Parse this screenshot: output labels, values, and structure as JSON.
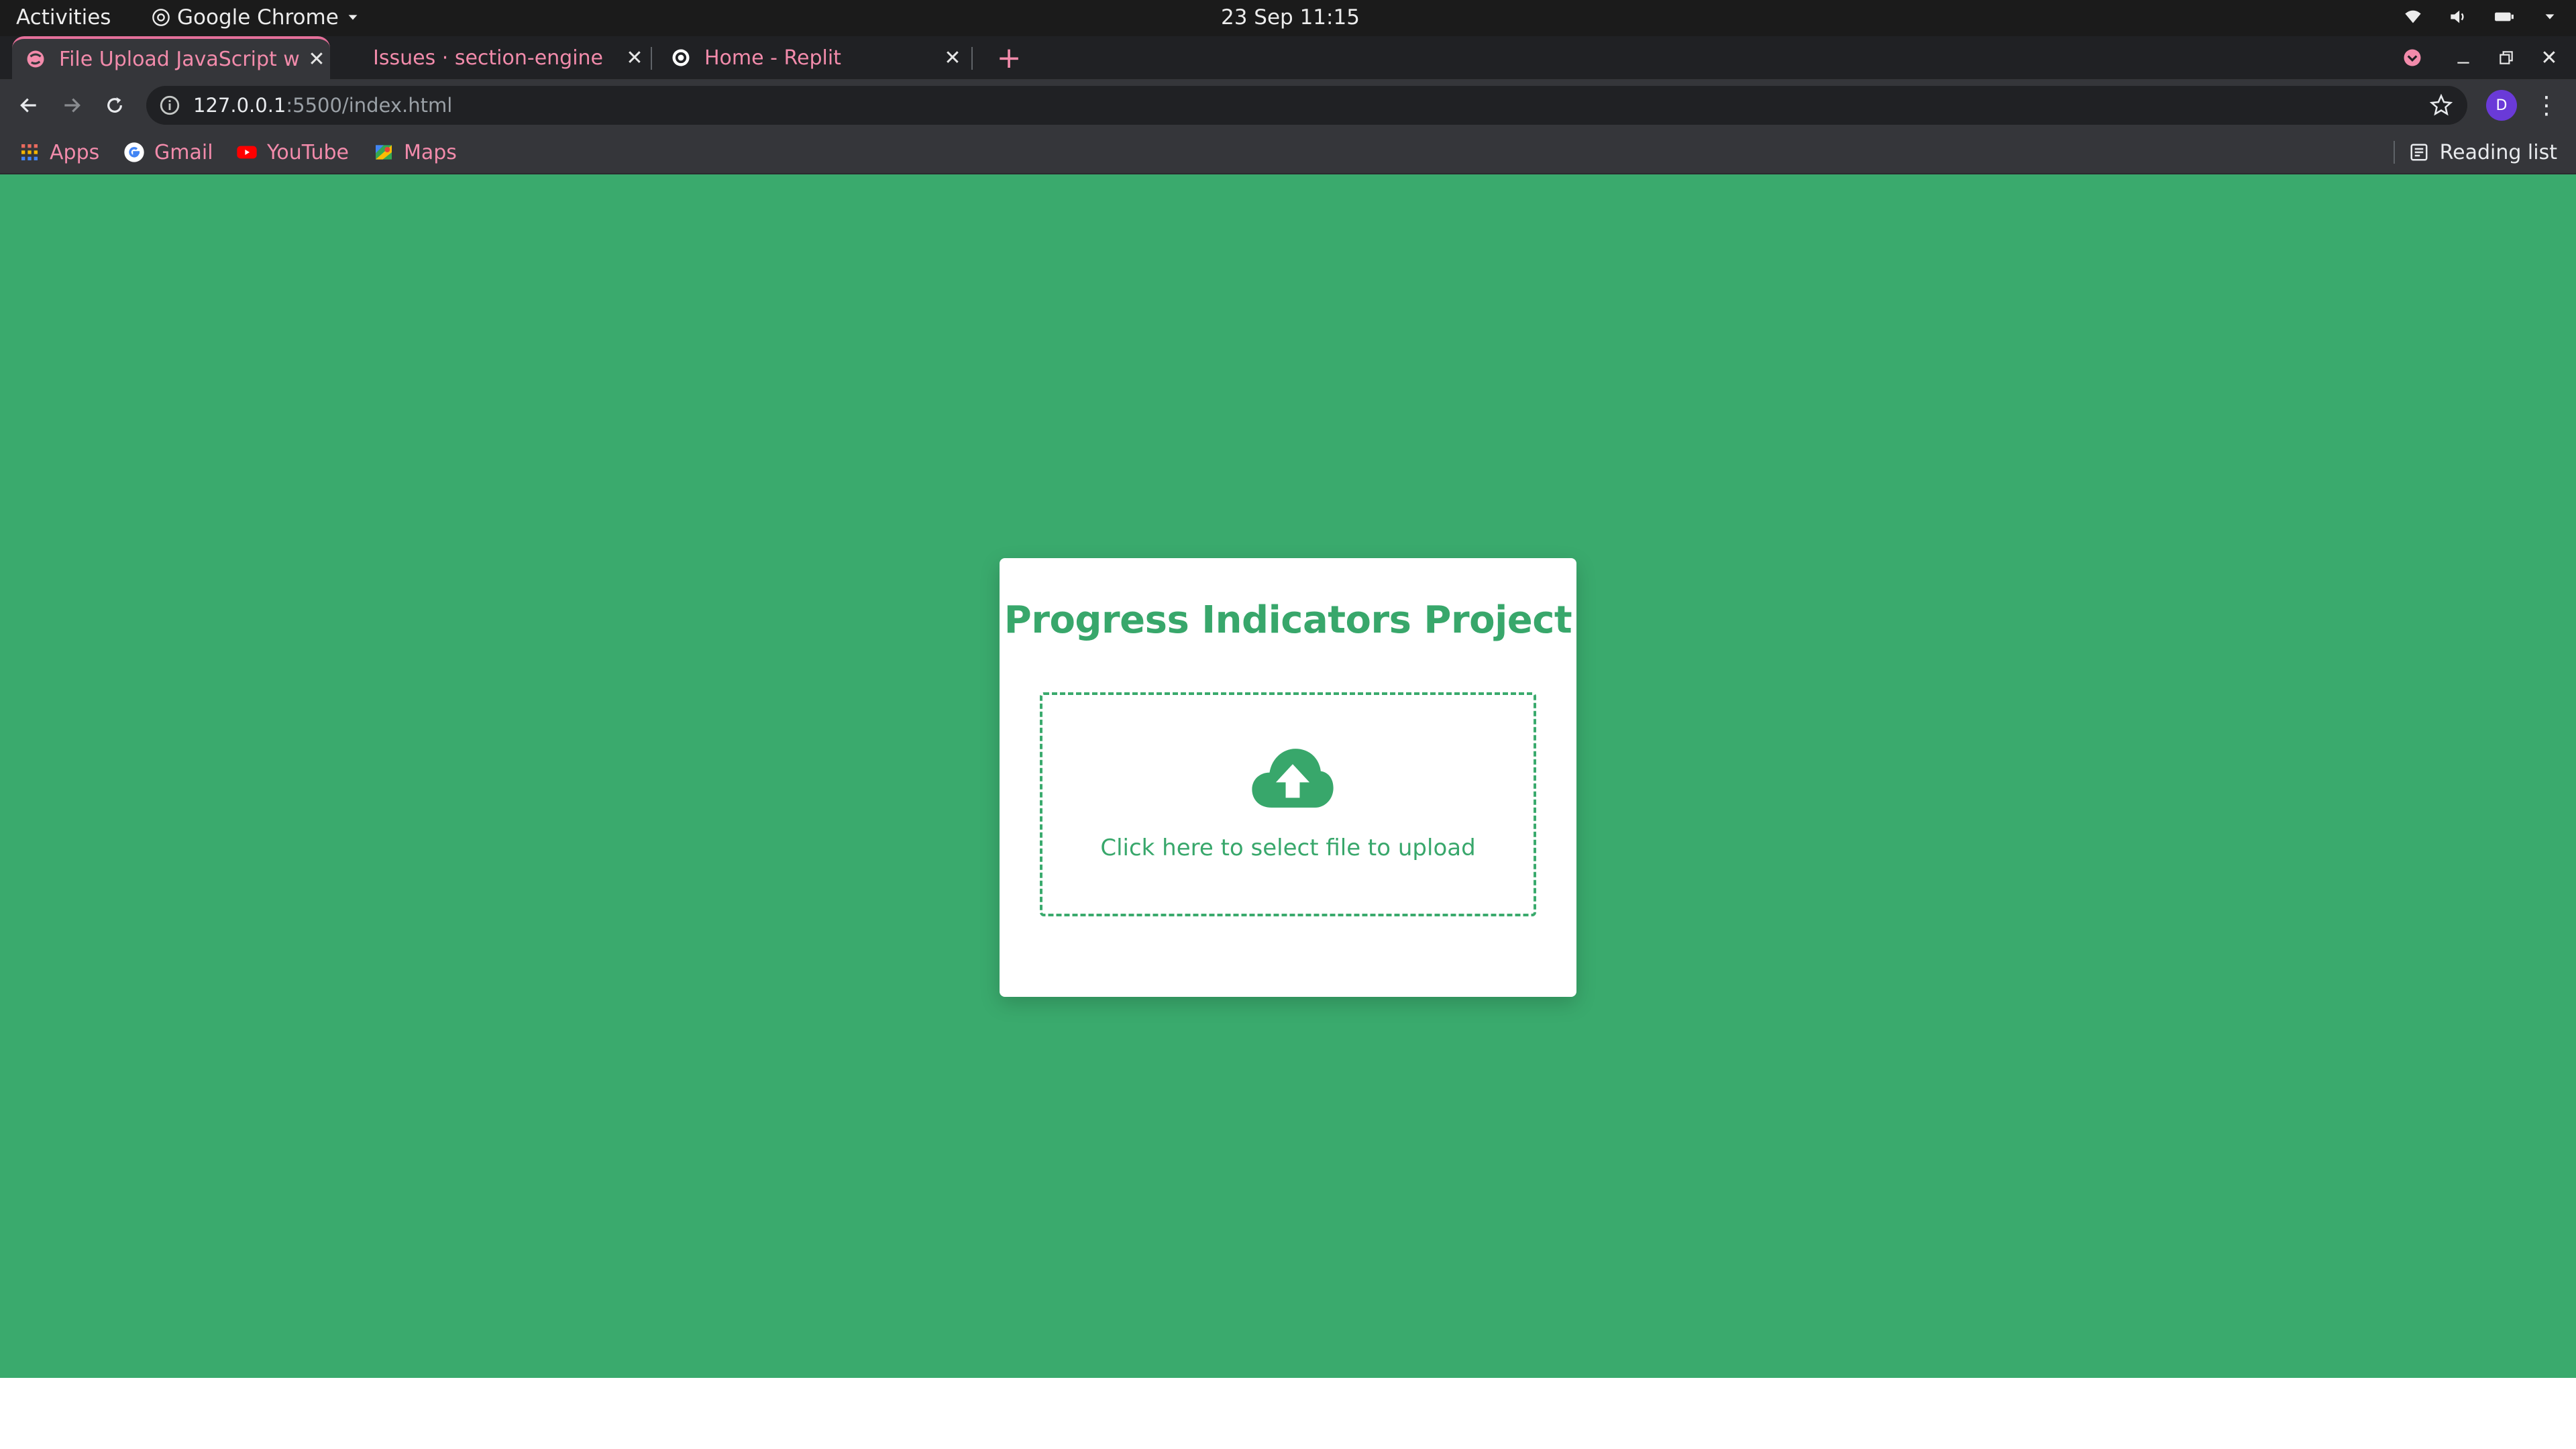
{
  "system_bar": {
    "activities": "Activities",
    "app_name": "Google Chrome",
    "clock": "23 Sep  11:15"
  },
  "tabs": [
    {
      "label": "File Upload JavaScript w",
      "active": true
    },
    {
      "label": "Issues · section-engine",
      "active": false
    },
    {
      "label": "Home - Replit",
      "active": false
    }
  ],
  "address_bar": {
    "host": "127.0.0.1",
    "path": ":5500/index.html"
  },
  "profile_initial": "D",
  "bookmarks": [
    {
      "label": "Apps",
      "icon": "apps-grid-icon"
    },
    {
      "label": "Gmail",
      "icon": "google-icon"
    },
    {
      "label": "YouTube",
      "icon": "youtube-icon"
    },
    {
      "label": "Maps",
      "icon": "maps-icon"
    }
  ],
  "reading_list": "Reading list",
  "card": {
    "title": "Progress Indicators Project",
    "upload_hint": "Click here to select file to upload"
  },
  "colors": {
    "page_bg": "#3aaa6d",
    "accent": "#38a76b",
    "tab_text": "#f28bab"
  }
}
